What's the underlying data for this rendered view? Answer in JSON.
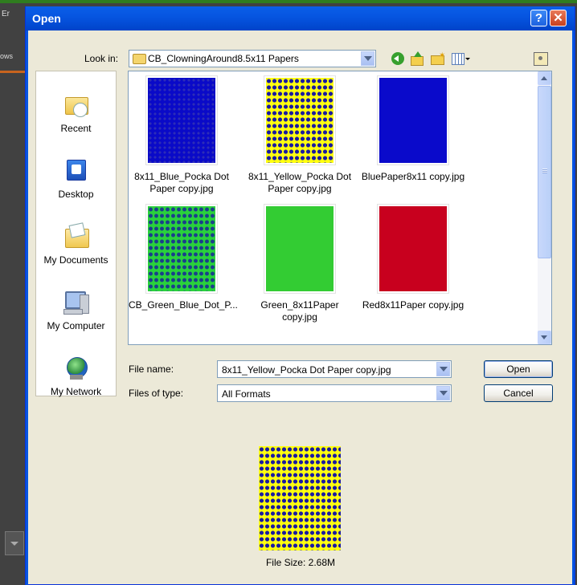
{
  "background": {
    "menu_text": "Er",
    "side_text": "ows"
  },
  "dialog": {
    "title": "Open",
    "help_label": "?",
    "close_label": "✕"
  },
  "lookin": {
    "label": "Look in:",
    "value": "CB_ClowningAround8.5x11 Papers"
  },
  "places": [
    {
      "label": "Recent"
    },
    {
      "label": "Desktop"
    },
    {
      "label": "My Documents"
    },
    {
      "label": "My Computer"
    },
    {
      "label": "My Network"
    }
  ],
  "files": [
    {
      "name": "8x11_Blue_Pocka Dot Paper copy.jpg",
      "thumb": "blue-dots"
    },
    {
      "name": "8x11_Yellow_Pocka Dot Paper copy.jpg",
      "thumb": "yellow-dots"
    },
    {
      "name": "BluePaper8x11 copy.jpg",
      "thumb": "solid-blue",
      "color": "#0a0acb"
    },
    {
      "name": "CB_Green_Blue_Dot_P...",
      "thumb": "green-dots"
    },
    {
      "name": "Green_8x11Paper copy.jpg",
      "thumb": "solid-green",
      "color": "#33cc33"
    },
    {
      "name": "Red8x11Paper copy.jpg",
      "thumb": "solid-red",
      "color": "#c8001e"
    }
  ],
  "filename": {
    "label": "File name:",
    "value": "8x11_Yellow_Pocka Dot Paper copy.jpg"
  },
  "filetype": {
    "label": "Files of type:",
    "value": "All Formats"
  },
  "buttons": {
    "open": "Open",
    "cancel": "Cancel"
  },
  "preview": {
    "file_size": "File Size: 2.68M"
  }
}
